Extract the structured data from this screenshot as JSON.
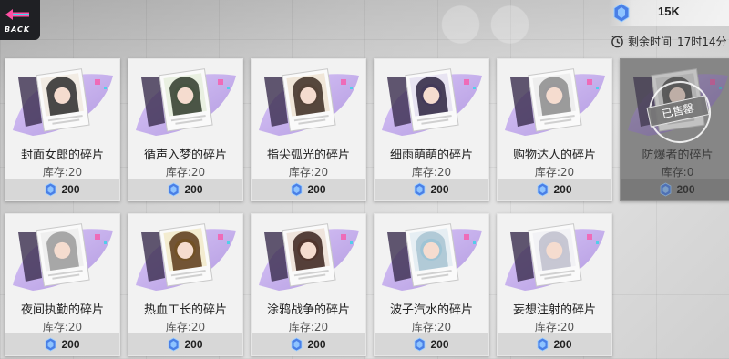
{
  "header": {
    "back_label": "BACK",
    "currency_icon": "chip-token-icon",
    "currency_amount": "15K",
    "timer_icon": "clock-icon",
    "timer_label": "剩余时间",
    "timer_value": "17时14分"
  },
  "colors": {
    "accent_purple": "#b48fe0",
    "accent_pink": "#ff4fa3",
    "accent_cyan": "#35d6e8",
    "sold_overlay": "#7f7f7f"
  },
  "shop": {
    "items": [
      {
        "name": "封面女郎的碎片",
        "stock": "库存:20",
        "price": "200",
        "sold": false,
        "sold_label": ""
      },
      {
        "name": "循声入梦的碎片",
        "stock": "库存:20",
        "price": "200",
        "sold": false,
        "sold_label": ""
      },
      {
        "name": "指尖弧光的碎片",
        "stock": "库存:20",
        "price": "200",
        "sold": false,
        "sold_label": ""
      },
      {
        "name": "细雨萌萌的碎片",
        "stock": "库存:20",
        "price": "200",
        "sold": false,
        "sold_label": ""
      },
      {
        "name": "购物达人的碎片",
        "stock": "库存:20",
        "price": "200",
        "sold": false,
        "sold_label": ""
      },
      {
        "name": "防爆者的碎片",
        "stock": "库存:0",
        "price": "200",
        "sold": true,
        "sold_label": "已售罄"
      },
      {
        "name": "夜间执勤的碎片",
        "stock": "库存:20",
        "price": "200",
        "sold": false,
        "sold_label": ""
      },
      {
        "name": "热血工长的碎片",
        "stock": "库存:20",
        "price": "200",
        "sold": false,
        "sold_label": ""
      },
      {
        "name": "涂鸦战争的碎片",
        "stock": "库存:20",
        "price": "200",
        "sold": false,
        "sold_label": ""
      },
      {
        "name": "波子汽水的碎片",
        "stock": "库存:20",
        "price": "200",
        "sold": false,
        "sold_label": ""
      },
      {
        "name": "妄想注射的碎片",
        "stock": "库存:20",
        "price": "200",
        "sold": false,
        "sold_label": ""
      }
    ]
  }
}
